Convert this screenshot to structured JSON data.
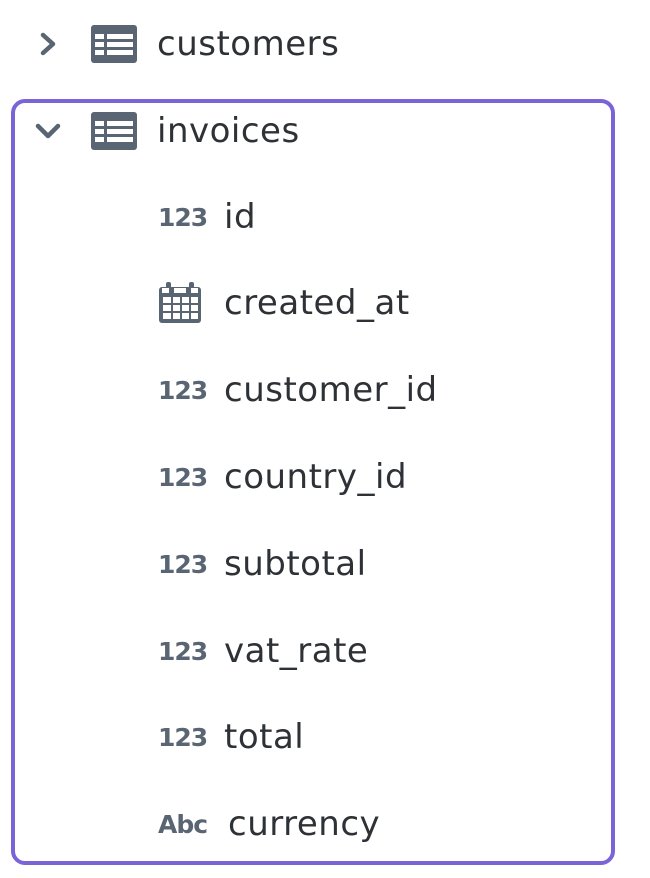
{
  "tree": {
    "tables": [
      {
        "name": "customers",
        "expanded": false,
        "chevron_icon": "chevron-right-icon",
        "icon": "table-icon"
      },
      {
        "name": "invoices",
        "expanded": true,
        "chevron_icon": "chevron-down-icon",
        "icon": "table-icon",
        "columns": [
          {
            "type_label": "123",
            "type_icon": "number-type-icon",
            "name": "id"
          },
          {
            "type_label": "",
            "type_icon": "calendar-icon",
            "name": "created_at"
          },
          {
            "type_label": "123",
            "type_icon": "number-type-icon",
            "name": "customer_id"
          },
          {
            "type_label": "123",
            "type_icon": "number-type-icon",
            "name": "country_id"
          },
          {
            "type_label": "123",
            "type_icon": "number-type-icon",
            "name": "subtotal"
          },
          {
            "type_label": "123",
            "type_icon": "number-type-icon",
            "name": "vat_rate"
          },
          {
            "type_label": "123",
            "type_icon": "number-type-icon",
            "name": "total"
          },
          {
            "type_label": "Abc",
            "type_icon": "text-type-icon",
            "name": "currency"
          }
        ]
      }
    ]
  },
  "colors": {
    "highlight_border": "#7b63d8",
    "icon_gray": "#5a6573",
    "text": "#2e3237"
  }
}
